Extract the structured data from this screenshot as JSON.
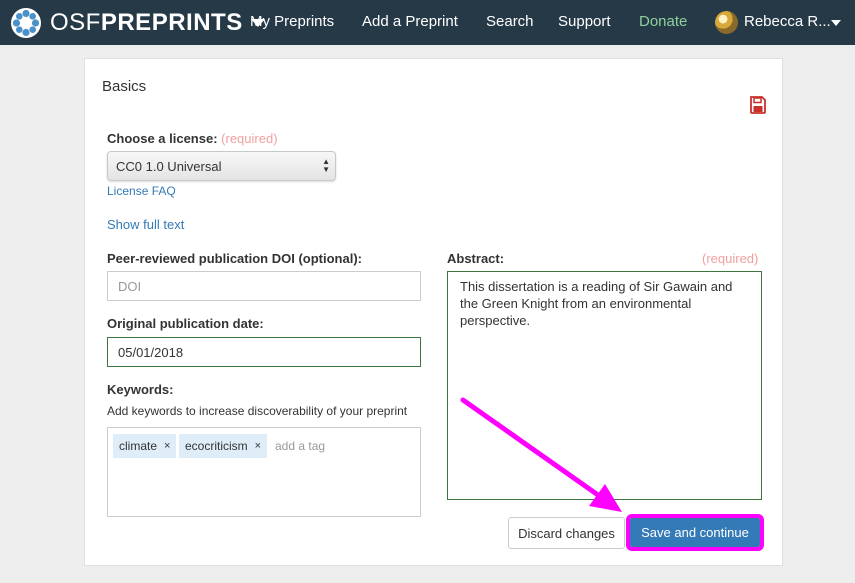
{
  "nav": {
    "brand_osf": "OSF",
    "brand_preprints": "PREPRINTS",
    "items": [
      {
        "label": "My Preprints"
      },
      {
        "label": "Add a Preprint"
      },
      {
        "label": "Search"
      },
      {
        "label": "Support"
      },
      {
        "label": "Donate"
      }
    ],
    "user_name": "Rebecca R..."
  },
  "panel": {
    "title": "Basics",
    "license": {
      "label": "Choose a license:",
      "required": "(required)",
      "selected": "CC0 1.0 Universal",
      "faq_link": "License FAQ",
      "full_text_link": "Show full text"
    },
    "doi": {
      "label": "Peer-reviewed publication DOI (optional):",
      "placeholder": "DOI"
    },
    "pub_date": {
      "label": "Original publication date:",
      "value": "05/01/2018"
    },
    "keywords": {
      "label": "Keywords:",
      "helper": "Add keywords to increase discoverability of your preprint",
      "tags": [
        "climate",
        "ecocriticism"
      ],
      "tag_remove": "×",
      "placeholder": "add a tag"
    },
    "abstract": {
      "label": "Abstract:",
      "required": "(required)",
      "value": "This dissertation is a reading of Sir Gawain and the Green Knight from an environmental perspective."
    },
    "buttons": {
      "discard": "Discard changes",
      "save": "Save and continue"
    }
  },
  "colors": {
    "navbar": "#263947",
    "donate": "#8fd19e",
    "primary": "#337ab7",
    "required": "#f0a0a0",
    "valid_border": "#3c763d",
    "highlight": "#ff00ff",
    "save_icon": "#c9302c"
  },
  "icons": {
    "brand": "osf-flower-logo-icon",
    "brand_menu": "caret-down-icon",
    "user": "avatar",
    "user_menu": "caret-down-icon",
    "save": "floppy-disk-icon",
    "select": "select-arrows-icon",
    "tag_remove": "close-icon"
  }
}
